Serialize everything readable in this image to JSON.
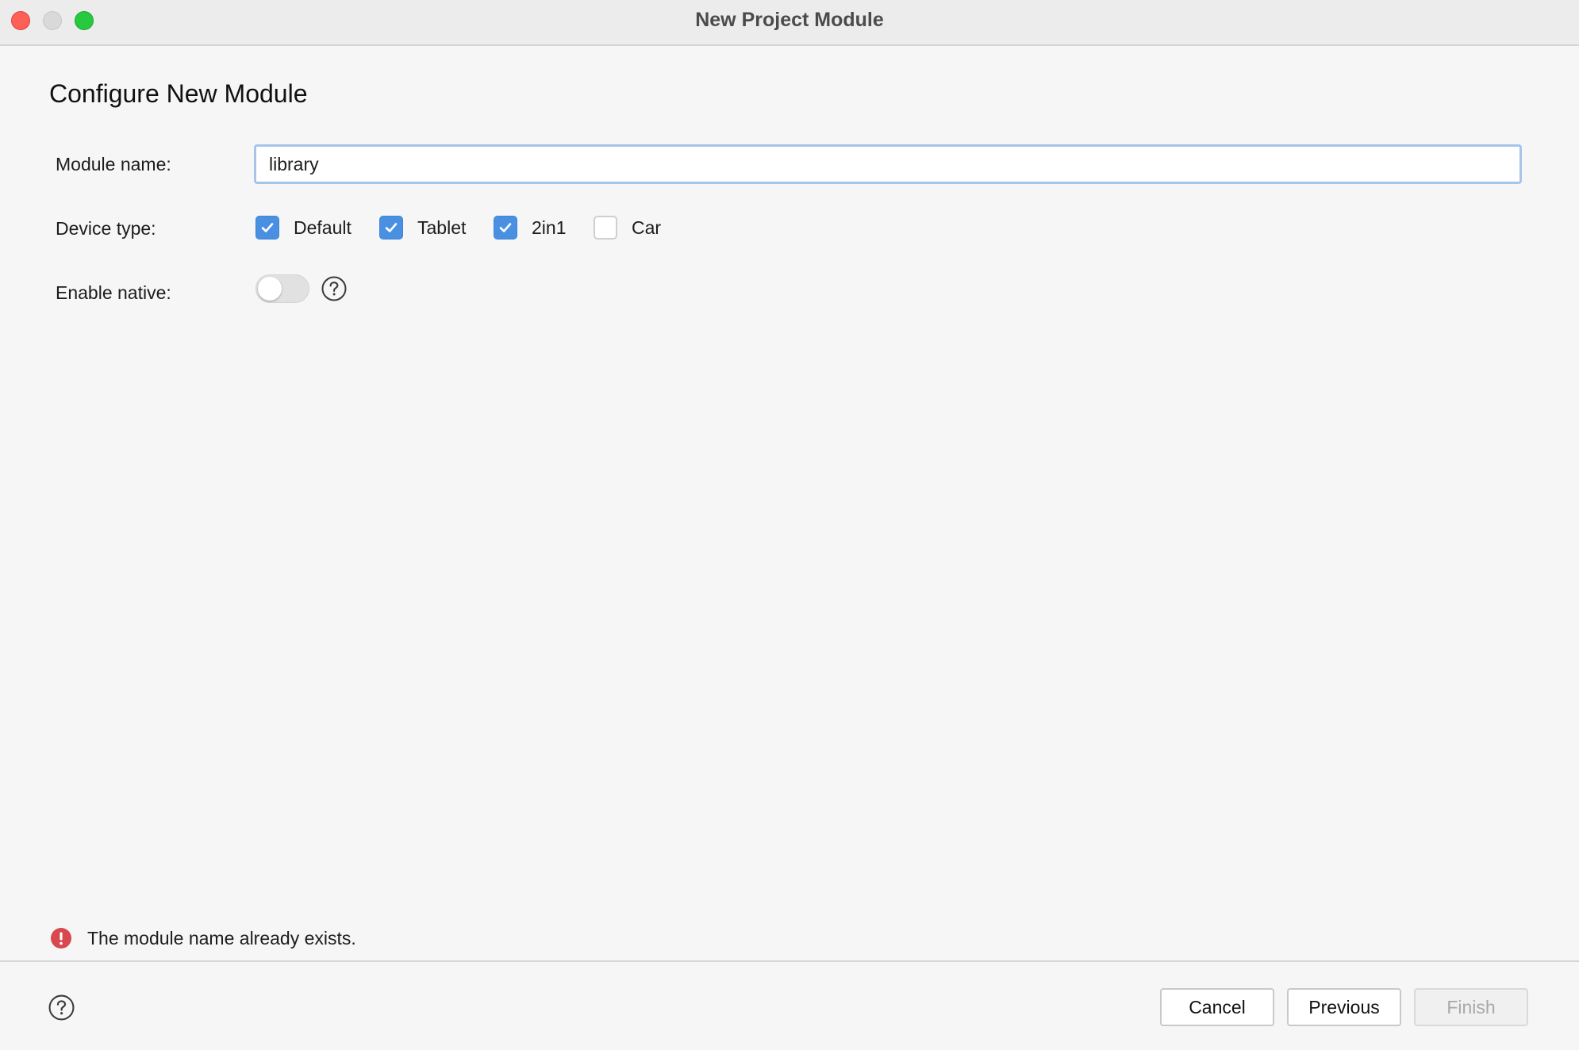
{
  "window": {
    "title": "New Project Module"
  },
  "page": {
    "title": "Configure New Module"
  },
  "form": {
    "module_name_label": "Module name:",
    "module_name_value": "library",
    "device_type_label": "Device type:",
    "device_types": [
      {
        "label": "Default",
        "checked": true
      },
      {
        "label": "Tablet",
        "checked": true
      },
      {
        "label": "2in1",
        "checked": true
      },
      {
        "label": "Car",
        "checked": false
      }
    ],
    "enable_native_label": "Enable native:",
    "enable_native_on": false
  },
  "error": {
    "message": "The module name already exists.",
    "color": "#d9474f"
  },
  "buttons": {
    "cancel": "Cancel",
    "previous": "Previous",
    "finish": "Finish"
  },
  "colors": {
    "checkbox_accent": "#4a90e2",
    "input_focus_border": "#a6c5ec"
  },
  "icons": {
    "close": "close-traffic-light",
    "minimize": "minimize-traffic-light",
    "zoom": "zoom-traffic-light",
    "help": "question-circle-icon",
    "error": "exclamation-circle-icon",
    "check": "checkmark-icon"
  }
}
